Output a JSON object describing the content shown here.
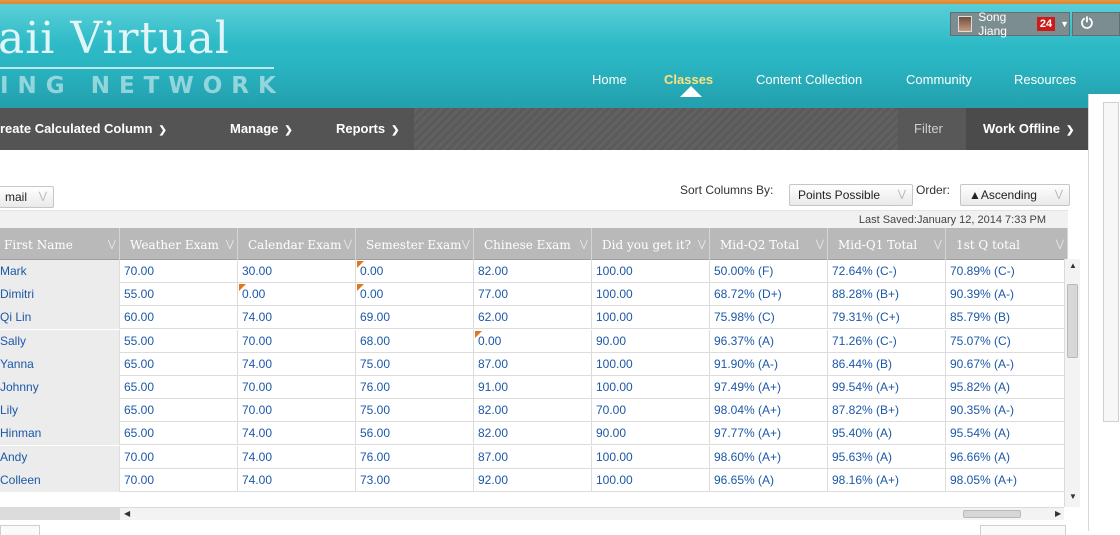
{
  "brand": {
    "line1": "aii Virtual",
    "line2": "ING NETWORK"
  },
  "nav": {
    "items": [
      {
        "label": "Home"
      },
      {
        "label": "Classes",
        "active": true
      },
      {
        "label": "Content Collection"
      },
      {
        "label": "Community"
      },
      {
        "label": "Resources"
      }
    ]
  },
  "user": {
    "name": "Song Jiang",
    "notifications": "24"
  },
  "toolbar": {
    "create_column": "reate Calculated Column",
    "manage": "Manage",
    "reports": "Reports",
    "filter": "Filter",
    "work_offline": "Work Offline"
  },
  "controls": {
    "email_label": "mail",
    "sort_label": "Sort Columns By:",
    "sort_value": "Points Possible",
    "order_label": "Order:",
    "order_value": "▲Ascending",
    "last_saved": "Last Saved:January 12, 2014 7:33 PM"
  },
  "grid": {
    "columns": [
      "First Name",
      "Weather Exam",
      "Calendar Exam",
      "Semester Exam",
      "Chinese Exam",
      "Did you get it?",
      "Mid-Q2 Total",
      "Mid-Q1 Total",
      "1st Q total"
    ],
    "rows": [
      {
        "name": "Mark",
        "cells": [
          "70.00",
          "30.00",
          "0.00",
          "82.00",
          "100.00",
          "50.00% (F)",
          "72.64% (C-)",
          "70.89% (C-)"
        ],
        "flags": [
          2
        ]
      },
      {
        "name": "Dimitri",
        "cells": [
          "55.00",
          "0.00",
          "0.00",
          "77.00",
          "100.00",
          "68.72% (D+)",
          "88.28% (B+)",
          "90.39% (A-)"
        ],
        "flags": [
          1,
          2
        ]
      },
      {
        "name": "Qi Lin",
        "cells": [
          "60.00",
          "74.00",
          "69.00",
          "62.00",
          "100.00",
          "75.98% (C)",
          "79.31% (C+)",
          "85.79% (B)"
        ],
        "flags": []
      },
      {
        "name": "Sally",
        "cells": [
          "55.00",
          "70.00",
          "68.00",
          "0.00",
          "90.00",
          "96.37% (A)",
          "71.26% (C-)",
          "75.07% (C)"
        ],
        "flags": [
          3
        ]
      },
      {
        "name": "Yanna",
        "cells": [
          "65.00",
          "74.00",
          "75.00",
          "87.00",
          "100.00",
          "91.90% (A-)",
          "86.44% (B)",
          "90.67% (A-)"
        ],
        "flags": []
      },
      {
        "name": "Johnny",
        "cells": [
          "65.00",
          "70.00",
          "76.00",
          "91.00",
          "100.00",
          "97.49% (A+)",
          "99.54% (A+)",
          "95.82% (A)"
        ],
        "flags": []
      },
      {
        "name": "Lily",
        "cells": [
          "65.00",
          "70.00",
          "75.00",
          "82.00",
          "70.00",
          "98.04% (A+)",
          "87.82% (B+)",
          "90.35% (A-)"
        ],
        "flags": []
      },
      {
        "name": "Hinman",
        "cells": [
          "65.00",
          "74.00",
          "56.00",
          "82.00",
          "90.00",
          "97.77% (A+)",
          "95.40% (A)",
          "95.54% (A)"
        ],
        "flags": []
      },
      {
        "name": "Andy",
        "cells": [
          "70.00",
          "74.00",
          "76.00",
          "87.00",
          "100.00",
          "98.60% (A+)",
          "95.63% (A)",
          "96.66% (A)"
        ],
        "flags": []
      },
      {
        "name": "Colleen",
        "cells": [
          "70.00",
          "74.00",
          "73.00",
          "92.00",
          "100.00",
          "96.65% (A)",
          "98.16% (A+)",
          "98.05% (A+)"
        ],
        "flags": []
      }
    ]
  },
  "colors": {
    "accent": "#2ab6c3",
    "link": "#1c58a7",
    "flag": "#e0781b",
    "badge": "#cc1b1b"
  }
}
